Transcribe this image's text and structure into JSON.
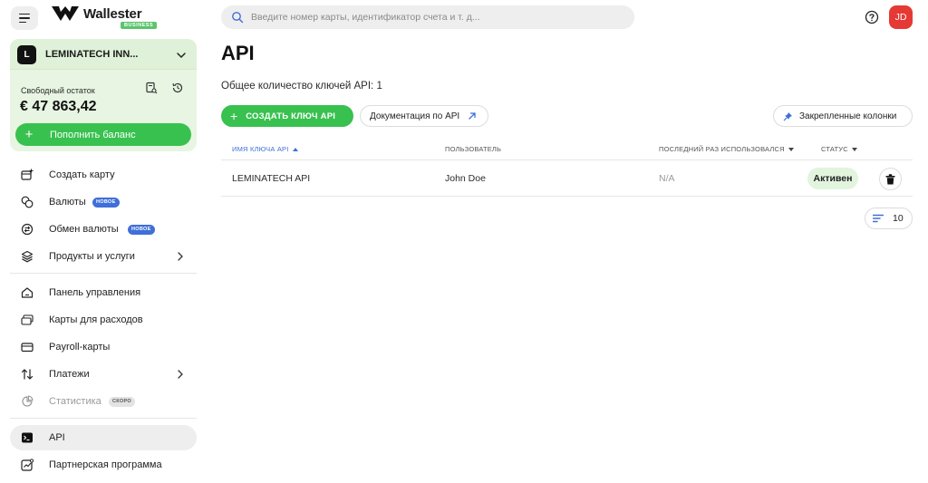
{
  "brand": {
    "name": "Wallester",
    "badge": "BUSINESS"
  },
  "search": {
    "placeholder": "Введите номер карты, идентификатор счета и т. д..."
  },
  "user": {
    "initials": "JD"
  },
  "account": {
    "name": "LEMINATECH INN...",
    "logo_letter": "L",
    "balance_label": "Свободный остаток",
    "balance_value": "€ 47 863,42",
    "topup_label": "Пополнить баланс"
  },
  "sidebar": {
    "items": [
      {
        "label": "Создать карту"
      },
      {
        "label": "Валюты",
        "badge": "НОВОЕ"
      },
      {
        "label": "Обмен валюты",
        "badge": "НОВОЕ"
      },
      {
        "label": "Продукты и услуги"
      },
      {
        "label": "Панель управления"
      },
      {
        "label": "Карты для расходов"
      },
      {
        "label": "Payroll-карты"
      },
      {
        "label": "Платежи"
      },
      {
        "label": "Статистика",
        "badge": "СКОРО"
      },
      {
        "label": "API"
      },
      {
        "label": "Партнерская программа"
      }
    ]
  },
  "main": {
    "title": "API",
    "keys_count": "Общее количество ключей API: 1",
    "create_label": "СОЗДАТЬ КЛЮЧ API",
    "docs_label": "Документация по API",
    "pinned_label": "Закрепленные колонки",
    "columns": [
      "ИМЯ КЛЮЧА API",
      "ПОЛЬЗОВАТЕЛЬ",
      "ПОСЛЕДНИЙ РАЗ ИСПОЛЬЗОВАЛСЯ",
      "СТАТУС"
    ],
    "rows": [
      {
        "name": "LEMINATECH API",
        "user": "John Doe",
        "last_used": "N/A",
        "status": "Активен"
      }
    ],
    "page_size": "10"
  },
  "colors": {
    "accent_green": "#38c14f",
    "card_green": "#e7f5e2",
    "status_green": "#e2f4de",
    "new_badge_blue": "#3f6fd8",
    "avatar_red": "#e53935"
  }
}
